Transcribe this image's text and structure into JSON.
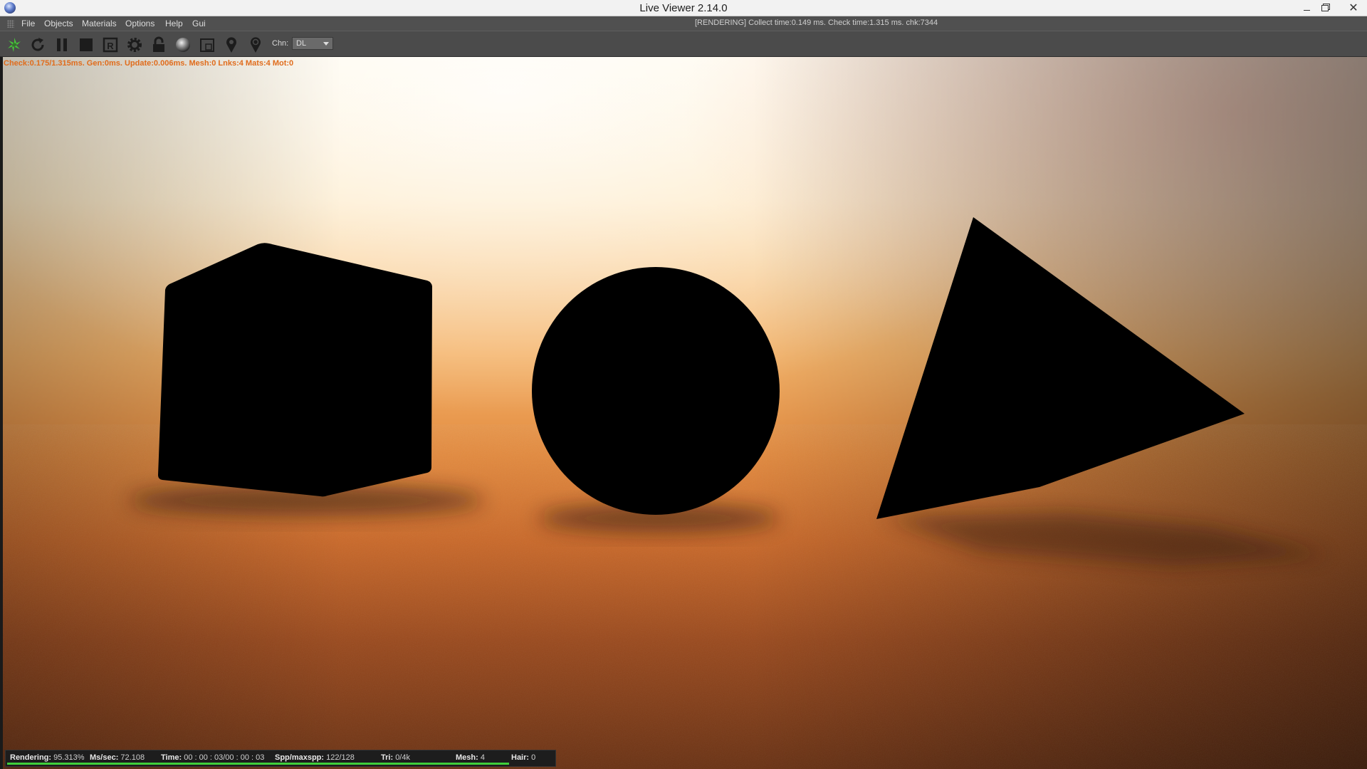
{
  "window": {
    "title": "Live Viewer 2.14.0",
    "min_icon": "minimize-icon",
    "max_icon": "restore-icon",
    "close_glyph": "✕"
  },
  "menu": {
    "items": [
      "File",
      "Objects",
      "Materials",
      "Options",
      "Help",
      "Gui"
    ],
    "status": "[RENDERING] Collect time:0.149 ms.  Check time:1.315 ms.  chk:7344"
  },
  "toolbar": {
    "icons": [
      "octane-logo-icon",
      "refresh-icon",
      "pause-icon",
      "stop-icon",
      "render-region-icon",
      "settings-gear-icon",
      "lock-icon",
      "material-ball-icon",
      "region-select-icon",
      "pin-icon",
      "pin-focus-icon"
    ],
    "chn_label": "Chn:",
    "chn_value": "DL"
  },
  "viewport": {
    "stats": "Check:0.175/1.315ms. Gen:0ms. Update:0.006ms. Mesh:0 Lnks:4 Mats:4 Mot:0",
    "objects": [
      "cube",
      "sphere",
      "pyramid"
    ]
  },
  "render_status": {
    "rendering_label": "Rendering:",
    "rendering_value": "95.313%",
    "mssec_label": "Ms/sec:",
    "mssec_value": "72.108",
    "time_label": "Time:",
    "time_value": "00 : 00 : 03/00 : 00 : 03",
    "spp_label": "Spp/maxspp:",
    "spp_value": "122/128",
    "tri_label": "Tri:",
    "tri_value": "0/4k",
    "mesh_label": "Mesh:",
    "mesh_value": "4",
    "hair_label": "Hair:",
    "hair_value": "0",
    "progress": 0.953
  },
  "colors": {
    "accent_orange": "#e06c1c",
    "progress_green": "#3fcf3a",
    "logo_green": "#47c43a"
  }
}
